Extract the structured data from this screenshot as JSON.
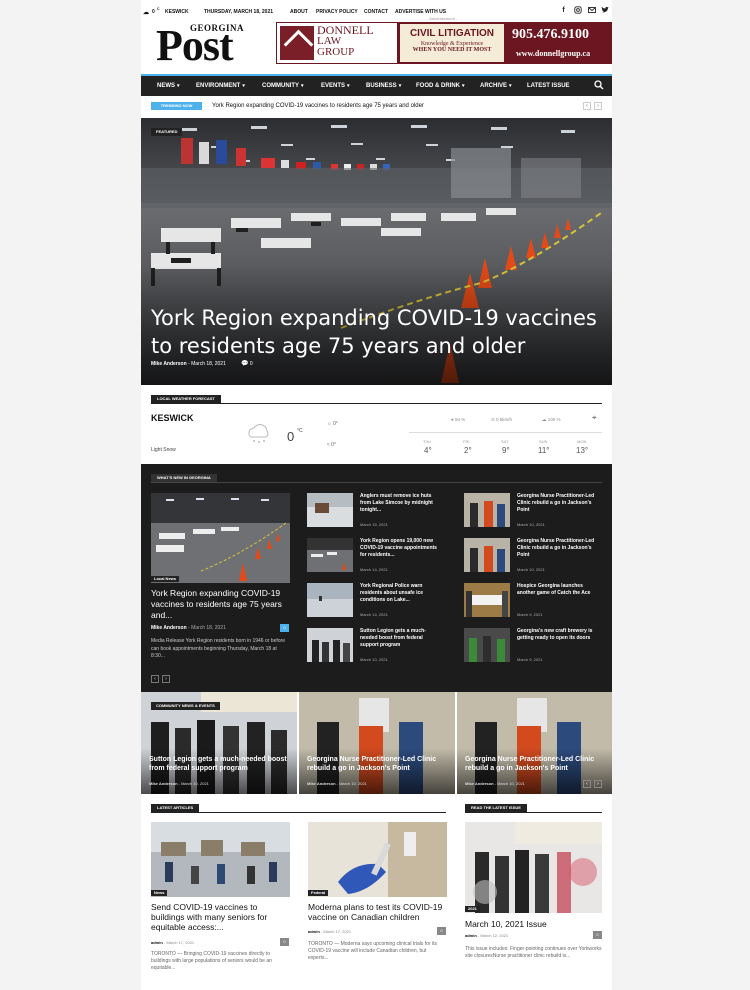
{
  "topbar": {
    "temp": "0",
    "unit": "C",
    "city": "KESWICK",
    "date": "THURSDAY, MARCH 18, 2021",
    "links": [
      "ABOUT",
      "PRIVACY POLICY",
      "CONTACT",
      "ADVERTISE WITH US"
    ],
    "social_icons": [
      "facebook-icon",
      "instagram-icon",
      "mail-icon",
      "twitter-icon"
    ]
  },
  "logo": {
    "small": "GEORGINA",
    "big": "Post"
  },
  "ad": {
    "label": "- Advertisement -",
    "name_lines": [
      "DONNELL",
      "LAW",
      "GROUP"
    ],
    "headline": "CIVIL LITIGATION",
    "sub1": "Knowledge & Experience",
    "sub2": "WHEN YOU NEED IT MOST",
    "phone": "905.476.9100",
    "url": "www.donnellgroup.ca",
    "color": "#6b1620"
  },
  "nav": {
    "items": [
      "NEWS",
      "ENVIRONMENT",
      "COMMUNITY",
      "EVENTS",
      "BUSINESS",
      "FOOD & DRINK",
      "ARCHIVE",
      "LATEST ISSUE"
    ],
    "accent": "#4db2ec"
  },
  "trending": {
    "label": "TRENDING NOW",
    "text": "York Region expanding COVID-19 vaccines to residents age 75 years and older"
  },
  "hero": {
    "tag": "FEATURED",
    "title": "York Region expanding COVID-19 vaccines to residents age 75 years and older",
    "author": "Mike Anderson",
    "date": "March 18, 2021",
    "comments": "0"
  },
  "weather": {
    "label": "LOCAL WEATHER FORECAST",
    "city": "KESWICK",
    "condition": "Light Snow",
    "temp": "0",
    "unit": "°C",
    "high": "0",
    "low": "0",
    "humidity": "94 %",
    "wind": "0.5km/h",
    "clouds": "100 %",
    "days": [
      {
        "day": "THU",
        "temp": "4°"
      },
      {
        "day": "FRI",
        "temp": "2°"
      },
      {
        "day": "SAT",
        "temp": "9°"
      },
      {
        "day": "SUN",
        "temp": "11°"
      },
      {
        "day": "MON",
        "temp": "13°"
      }
    ]
  },
  "whats_new": {
    "label": "WHAT'S NEW IN GEORGINA",
    "main": {
      "cat": "Local News",
      "title": "York Region expanding COVID-19 vaccines to residents age 75 years and...",
      "author": "Mike Anderson",
      "date": "March 18, 2021",
      "comments": "0",
      "excerpt": "Media Release York Region residents born in 1946 or before can book appointments beginning Thursday, March 18 at 8:30..."
    },
    "col2": [
      {
        "title": "Anglers must remove ice huts from Lake Simcoe by midnight tonight...",
        "date": "March 15, 2021"
      },
      {
        "title": "York Region opens 19,000 new COVID-19 vaccine appointments for residents...",
        "date": "March 14, 2021"
      },
      {
        "title": "York Regional Police warn residents about unsafe ice conditions on Lake...",
        "date": "March 14, 2021"
      },
      {
        "title": "Sutton Legion gets a much-needed boost from federal support program",
        "date": "March 10, 2021"
      }
    ],
    "col3": [
      {
        "title": "Georgina Nurse Practitioner-Led Clinic rebuild a go in Jackson's Point",
        "date": "March 10, 2021"
      },
      {
        "title": "Georgina Nurse Practitioner-Led Clinic rebuild a go in Jackson's Point",
        "date": "March 10, 2021"
      },
      {
        "title": "Hospice Georgina launches another game of Catch the Ace",
        "date": "March 9, 2021"
      },
      {
        "title": "Georgina's new craft brewery is getting ready to open its doors",
        "date": "March 9, 2021"
      }
    ]
  },
  "community": {
    "label": "COMMUNITY NEWS & EVENTS",
    "cards": [
      {
        "title": "Sutton Legion gets a much-needed boost from federal support program",
        "author": "Mike Anderson",
        "date": "March 10, 2021"
      },
      {
        "title": "Georgina Nurse Practitioner-Led Clinic rebuild a go in Jackson's Point",
        "author": "Mike Anderson",
        "date": "March 10, 2021"
      },
      {
        "title": "Georgina Nurse Practitioner-Led Clinic rebuild a go in Jackson's Point",
        "author": "Mike Anderson",
        "date": "March 10, 2021"
      }
    ]
  },
  "latest": {
    "label": "LATEST ARTICLES",
    "articles": [
      {
        "cat": "News",
        "title": "Send COVID-19 vaccines to buildings with many seniors for equitable access:...",
        "author": "admin",
        "date": "March 17, 2021",
        "comments": "0",
        "excerpt": "TORONTO — Bringing COVID-19 vaccines directly to buildings with large populations of seniors would be an equitable..."
      },
      {
        "cat": "Federal",
        "title": "Moderna plans to test its COVID-19 vaccine on Canadian children",
        "author": "admin",
        "date": "March 17, 2021",
        "comments": "0",
        "excerpt": "TORONTO — Moderna says upcoming clinical trials for its COVID-19 vaccine will include Canadian children, but experts..."
      }
    ]
  },
  "issue": {
    "label": "READ THE LATEST ISSUE",
    "cat": "2021",
    "title": "March 10, 2021 Issue",
    "author": "admin",
    "date": "March 12, 2021",
    "comments": "0",
    "excerpt": "This issue includes: Finger-pointing continues over Yorkworks site closuresNurse practitioner clinic rebuild is..."
  }
}
